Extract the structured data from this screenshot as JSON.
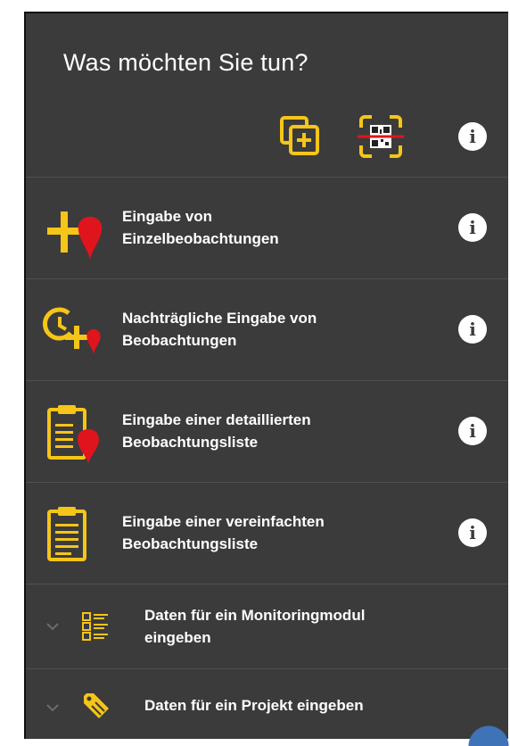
{
  "dialog": {
    "title": "Was möchten Sie tun?",
    "toolbar": {
      "add_icon": "add-copy-icon",
      "qr_icon": "qr-scan-icon",
      "info_symbol": "i"
    },
    "items": [
      {
        "label_line1": "Eingabe von",
        "label_line2": "Einzelbeobachtungen",
        "icon": "plus-marker-icon",
        "info_symbol": "i"
      },
      {
        "label_line1": "Nachträgliche Eingabe von",
        "label_line2": "Beobachtungen",
        "icon": "clock-plus-marker-icon",
        "info_symbol": "i"
      },
      {
        "label_line1": "Eingabe einer detaillierten",
        "label_line2": "Beobachtungsliste",
        "icon": "clipboard-marker-icon",
        "info_symbol": "i"
      },
      {
        "label_line1": "Eingabe einer vereinfachten",
        "label_line2": "Beobachtungsliste",
        "icon": "clipboard-icon",
        "info_symbol": "i"
      }
    ],
    "expandables": [
      {
        "label_line1": "Daten für ein Monitoringmodul",
        "label_line2": "eingeben",
        "icon": "checklist-icon",
        "chevron": "chevron-down-icon"
      },
      {
        "label_line1": "Daten für ein Projekt eingeben",
        "icon": "tag-icon",
        "chevron": "chevron-down-icon"
      }
    ]
  },
  "colors": {
    "background": "#3b3b3b",
    "accent_yellow": "#f5c518",
    "accent_red": "#e0141c",
    "text": "#ffffff",
    "divider": "#505050"
  }
}
